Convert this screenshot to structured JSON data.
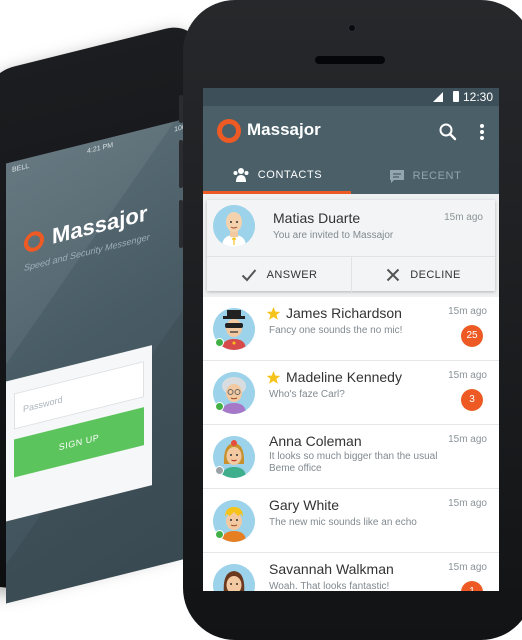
{
  "back_phone": {
    "status": {
      "carrier": "BELL",
      "time": "4:21 PM",
      "battery": "100%"
    },
    "brand": "Massajor",
    "tagline": "Speed and Security Messenger",
    "password_placeholder": "Password",
    "signup_label": "SIGN UP"
  },
  "status_bar": {
    "time": "12:30"
  },
  "app_bar": {
    "title": "Massajor"
  },
  "tabs": [
    {
      "label": "CONTACTS",
      "active": true
    },
    {
      "label": "RECENT",
      "active": false
    }
  ],
  "invite": {
    "name": "Matias Duarte",
    "message": "You are invited to Massajor",
    "time": "15m ago",
    "answer_label": "ANSWER",
    "decline_label": "DECLINE"
  },
  "contacts": [
    {
      "name": "James Richardson",
      "message": "Fancy one sounds the no mic!",
      "time": "15m ago",
      "badge": "25",
      "starred": true,
      "online": true
    },
    {
      "name": "Madeline Kennedy",
      "message": "Who's faze Carl?",
      "time": "15m ago",
      "badge": "3",
      "starred": true,
      "online": true
    },
    {
      "name": "Anna Coleman",
      "message": "It looks so much bigger than the usual Beme office",
      "time": "15m ago",
      "badge": "",
      "starred": false,
      "online": false
    },
    {
      "name": "Gary White",
      "message": "The new mic sounds like an echo",
      "time": "15m ago",
      "badge": "",
      "starred": false,
      "online": true
    },
    {
      "name": "Savannah Walkman",
      "message": "Woah. That looks fantastic!",
      "time": "15m ago",
      "badge": "1",
      "starred": false,
      "online": true
    }
  ],
  "colors": {
    "accent": "#ee5a24",
    "appbar": "#4a5f68",
    "online": "#43b047",
    "star": "#f6c31b"
  }
}
